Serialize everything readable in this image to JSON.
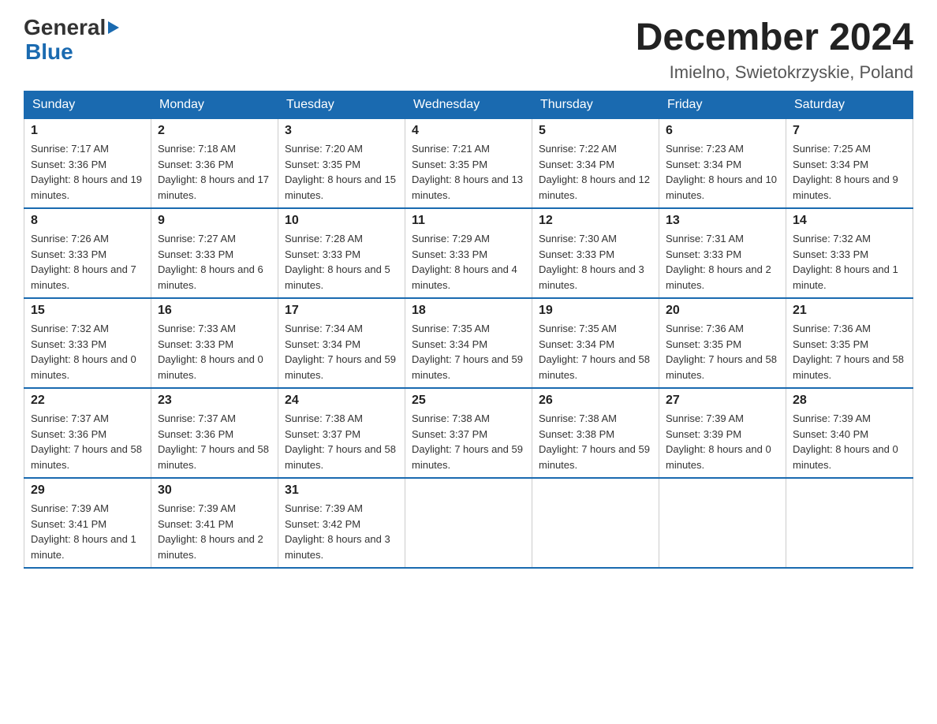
{
  "logo": {
    "text_general": "General",
    "text_blue": "Blue",
    "arrow": "▶"
  },
  "title": "December 2024",
  "subtitle": "Imielno, Swietokrzyskie, Poland",
  "days_header": [
    "Sunday",
    "Monday",
    "Tuesday",
    "Wednesday",
    "Thursday",
    "Friday",
    "Saturday"
  ],
  "weeks": [
    [
      {
        "day": "1",
        "sunrise": "7:17 AM",
        "sunset": "3:36 PM",
        "daylight": "8 hours and 19 minutes."
      },
      {
        "day": "2",
        "sunrise": "7:18 AM",
        "sunset": "3:36 PM",
        "daylight": "8 hours and 17 minutes."
      },
      {
        "day": "3",
        "sunrise": "7:20 AM",
        "sunset": "3:35 PM",
        "daylight": "8 hours and 15 minutes."
      },
      {
        "day": "4",
        "sunrise": "7:21 AM",
        "sunset": "3:35 PM",
        "daylight": "8 hours and 13 minutes."
      },
      {
        "day": "5",
        "sunrise": "7:22 AM",
        "sunset": "3:34 PM",
        "daylight": "8 hours and 12 minutes."
      },
      {
        "day": "6",
        "sunrise": "7:23 AM",
        "sunset": "3:34 PM",
        "daylight": "8 hours and 10 minutes."
      },
      {
        "day": "7",
        "sunrise": "7:25 AM",
        "sunset": "3:34 PM",
        "daylight": "8 hours and 9 minutes."
      }
    ],
    [
      {
        "day": "8",
        "sunrise": "7:26 AM",
        "sunset": "3:33 PM",
        "daylight": "8 hours and 7 minutes."
      },
      {
        "day": "9",
        "sunrise": "7:27 AM",
        "sunset": "3:33 PM",
        "daylight": "8 hours and 6 minutes."
      },
      {
        "day": "10",
        "sunrise": "7:28 AM",
        "sunset": "3:33 PM",
        "daylight": "8 hours and 5 minutes."
      },
      {
        "day": "11",
        "sunrise": "7:29 AM",
        "sunset": "3:33 PM",
        "daylight": "8 hours and 4 minutes."
      },
      {
        "day": "12",
        "sunrise": "7:30 AM",
        "sunset": "3:33 PM",
        "daylight": "8 hours and 3 minutes."
      },
      {
        "day": "13",
        "sunrise": "7:31 AM",
        "sunset": "3:33 PM",
        "daylight": "8 hours and 2 minutes."
      },
      {
        "day": "14",
        "sunrise": "7:32 AM",
        "sunset": "3:33 PM",
        "daylight": "8 hours and 1 minute."
      }
    ],
    [
      {
        "day": "15",
        "sunrise": "7:32 AM",
        "sunset": "3:33 PM",
        "daylight": "8 hours and 0 minutes."
      },
      {
        "day": "16",
        "sunrise": "7:33 AM",
        "sunset": "3:33 PM",
        "daylight": "8 hours and 0 minutes."
      },
      {
        "day": "17",
        "sunrise": "7:34 AM",
        "sunset": "3:34 PM",
        "daylight": "7 hours and 59 minutes."
      },
      {
        "day": "18",
        "sunrise": "7:35 AM",
        "sunset": "3:34 PM",
        "daylight": "7 hours and 59 minutes."
      },
      {
        "day": "19",
        "sunrise": "7:35 AM",
        "sunset": "3:34 PM",
        "daylight": "7 hours and 58 minutes."
      },
      {
        "day": "20",
        "sunrise": "7:36 AM",
        "sunset": "3:35 PM",
        "daylight": "7 hours and 58 minutes."
      },
      {
        "day": "21",
        "sunrise": "7:36 AM",
        "sunset": "3:35 PM",
        "daylight": "7 hours and 58 minutes."
      }
    ],
    [
      {
        "day": "22",
        "sunrise": "7:37 AM",
        "sunset": "3:36 PM",
        "daylight": "7 hours and 58 minutes."
      },
      {
        "day": "23",
        "sunrise": "7:37 AM",
        "sunset": "3:36 PM",
        "daylight": "7 hours and 58 minutes."
      },
      {
        "day": "24",
        "sunrise": "7:38 AM",
        "sunset": "3:37 PM",
        "daylight": "7 hours and 58 minutes."
      },
      {
        "day": "25",
        "sunrise": "7:38 AM",
        "sunset": "3:37 PM",
        "daylight": "7 hours and 59 minutes."
      },
      {
        "day": "26",
        "sunrise": "7:38 AM",
        "sunset": "3:38 PM",
        "daylight": "7 hours and 59 minutes."
      },
      {
        "day": "27",
        "sunrise": "7:39 AM",
        "sunset": "3:39 PM",
        "daylight": "8 hours and 0 minutes."
      },
      {
        "day": "28",
        "sunrise": "7:39 AM",
        "sunset": "3:40 PM",
        "daylight": "8 hours and 0 minutes."
      }
    ],
    [
      {
        "day": "29",
        "sunrise": "7:39 AM",
        "sunset": "3:41 PM",
        "daylight": "8 hours and 1 minute."
      },
      {
        "day": "30",
        "sunrise": "7:39 AM",
        "sunset": "3:41 PM",
        "daylight": "8 hours and 2 minutes."
      },
      {
        "day": "31",
        "sunrise": "7:39 AM",
        "sunset": "3:42 PM",
        "daylight": "8 hours and 3 minutes."
      },
      null,
      null,
      null,
      null
    ]
  ]
}
